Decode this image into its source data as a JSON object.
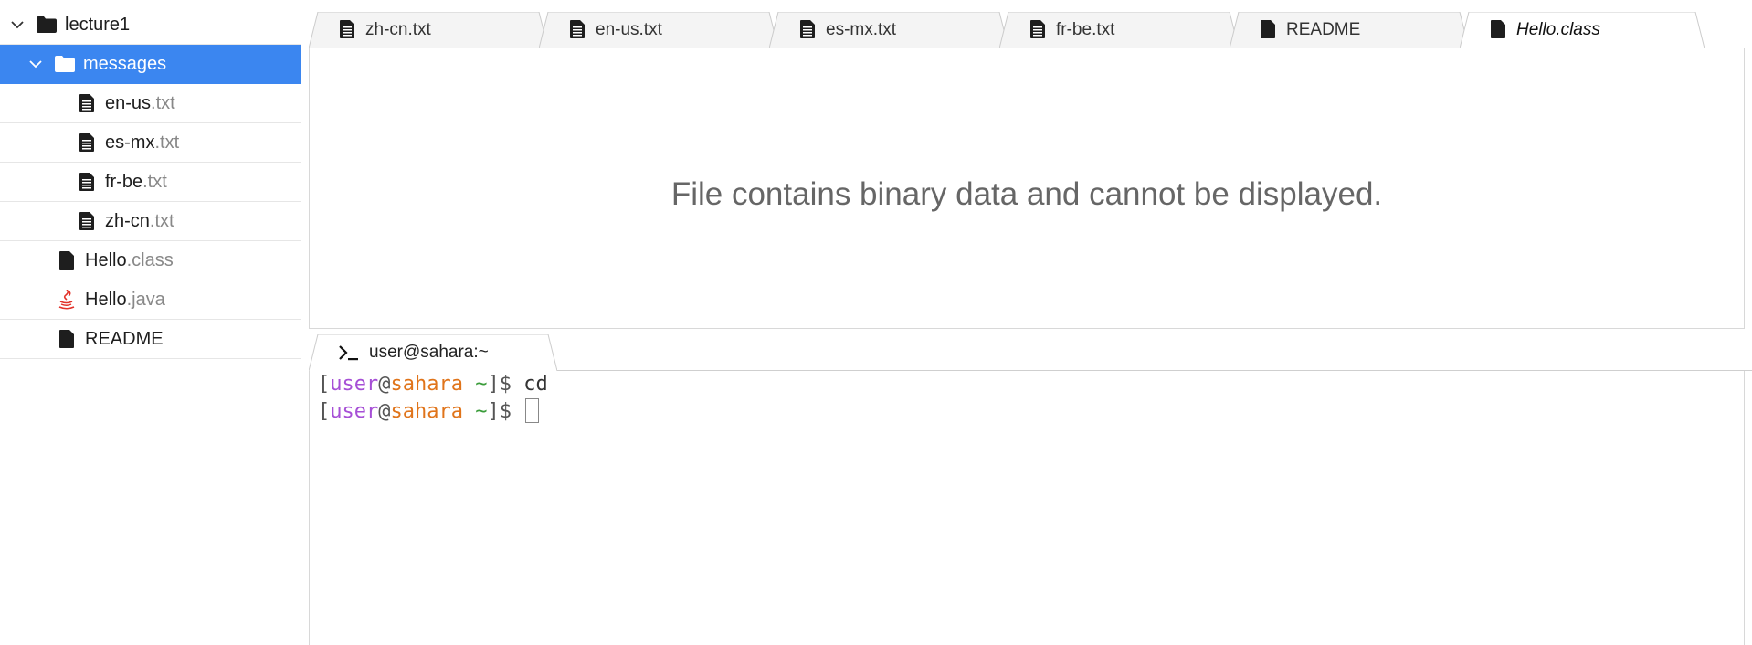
{
  "sidebar": {
    "items": [
      {
        "name": "lecture1",
        "ext": "",
        "type": "folder",
        "expanded": true,
        "selected": false
      },
      {
        "name": "messages",
        "ext": "",
        "type": "folder",
        "expanded": true,
        "selected": true
      },
      {
        "name": "en-us",
        "ext": ".txt",
        "type": "text-file",
        "selected": false
      },
      {
        "name": "es-mx",
        "ext": ".txt",
        "type": "text-file",
        "selected": false
      },
      {
        "name": "fr-be",
        "ext": ".txt",
        "type": "text-file",
        "selected": false
      },
      {
        "name": "zh-cn",
        "ext": ".txt",
        "type": "text-file",
        "selected": false
      },
      {
        "name": "Hello",
        "ext": ".class",
        "type": "binary-file",
        "selected": false
      },
      {
        "name": "Hello",
        "ext": ".java",
        "type": "java-file",
        "selected": false
      },
      {
        "name": "README",
        "ext": "",
        "type": "binary-file",
        "selected": false
      }
    ],
    "colors": {
      "selection": "#3b86f0"
    }
  },
  "editor": {
    "tabs": [
      {
        "label": "zh-cn.txt",
        "icon": "text-file-icon",
        "active": false
      },
      {
        "label": "en-us.txt",
        "icon": "text-file-icon",
        "active": false
      },
      {
        "label": "es-mx.txt",
        "icon": "text-file-icon",
        "active": false
      },
      {
        "label": "fr-be.txt",
        "icon": "text-file-icon",
        "active": false
      },
      {
        "label": "README",
        "icon": "file-icon",
        "active": false
      },
      {
        "label": "Hello.class",
        "icon": "file-icon",
        "active": true
      }
    ],
    "message": "File contains binary data and cannot be displayed."
  },
  "terminal": {
    "tab_label": "user@sahara:~",
    "prompt": {
      "open": "[",
      "user": "user",
      "at": "@",
      "host": "sahara",
      "path": "~",
      "close": "]$"
    },
    "lines": [
      {
        "command": "cd"
      },
      {
        "command": ""
      }
    ],
    "colors": {
      "user": "#a64fd6",
      "host": "#e0741a",
      "path": "#3a9c3a"
    }
  }
}
